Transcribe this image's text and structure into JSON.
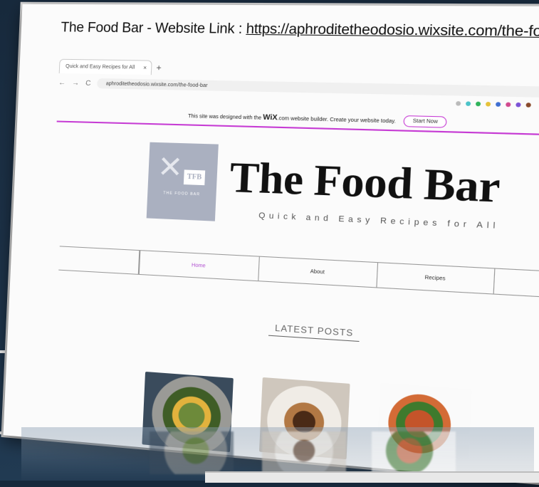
{
  "caption": {
    "label": "The Food Bar - Website Link : ",
    "url": "https://aphroditetheodosio.wixsite.com/the-food-bar"
  },
  "browser": {
    "tab_title": "Quick and Easy Recipes for All",
    "tab_close": "×",
    "new_tab": "+",
    "back": "←",
    "forward": "→",
    "reload": "C",
    "address": "aphroditetheodosio.wixsite.com/the-food-bar"
  },
  "wix_banner": {
    "text_before": "This site was designed with the",
    "brand": "WiX",
    "text_after": ".com website builder. Create your website today.",
    "button": "Start Now"
  },
  "site": {
    "logo_initials": "TFB",
    "logo_subtitle": "THE FOOD BAR",
    "title": "The Food Bar",
    "tagline": "Quick and Easy Recipes for All",
    "menu": [
      "Home",
      "About",
      "Recipes"
    ],
    "section_heading": "LATEST POSTS"
  },
  "colors": {
    "accent": "#c63bd4",
    "logo_bg": "#aab0c0"
  }
}
